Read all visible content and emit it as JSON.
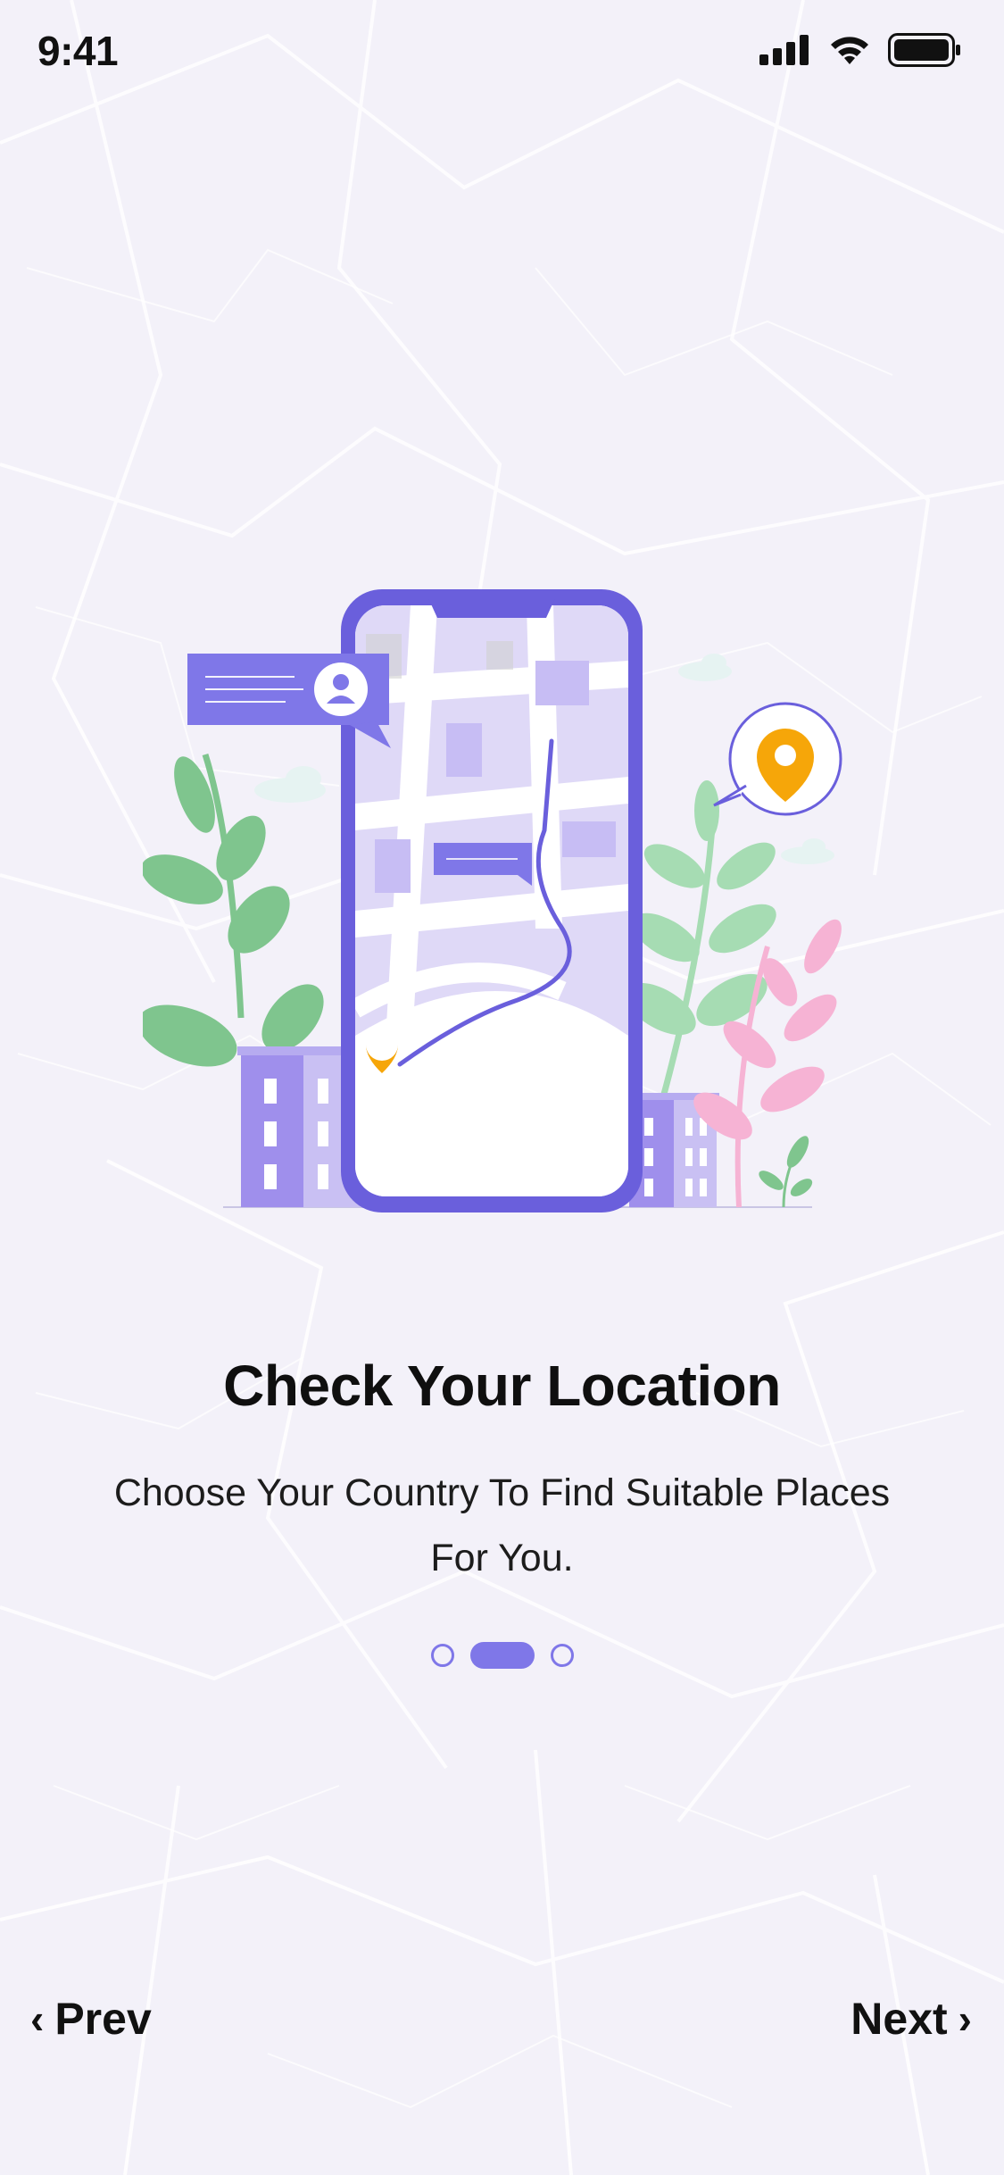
{
  "status_bar": {
    "time": "9:41"
  },
  "onboarding": {
    "title": "Check Your Location",
    "subtitle": "Choose Your Country To Find Suitable Places For You.",
    "pager": {
      "total_pages": 3,
      "current_page": 2
    }
  },
  "navigation": {
    "prev_label": "Prev",
    "next_label": "Next",
    "prev_icon": "chevron-left-icon",
    "next_icon": "chevron-right-icon"
  },
  "colors": {
    "background": "#f3f1f9",
    "accent": "#7f77e8",
    "phone_frame": "#6a5fdc",
    "pin": "#f6a609",
    "leaf_green": "#7fc58e",
    "leaf_pink": "#f6b3d4"
  }
}
